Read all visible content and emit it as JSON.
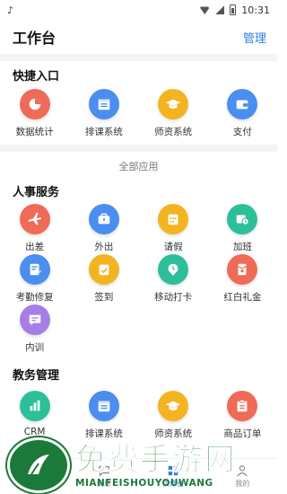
{
  "status_bar": {
    "time": "10:31"
  },
  "header": {
    "title": "工作台",
    "manage": "管理"
  },
  "quick_entry": {
    "title": "快捷入口",
    "items": [
      {
        "label": "数据统计",
        "icon": "pie-chart-icon",
        "color": "#ef6b57"
      },
      {
        "label": "排课系统",
        "icon": "schedule-icon",
        "color": "#4a8ef0"
      },
      {
        "label": "师资系统",
        "icon": "graduation-cap-icon",
        "color": "#f4b321"
      },
      {
        "label": "支付",
        "icon": "wallet-icon",
        "color": "#4a8ef0"
      }
    ]
  },
  "all_apps": "全部应用",
  "hr": {
    "title": "人事服务",
    "items": [
      {
        "label": "出差",
        "icon": "airplane-icon",
        "color": "#ef6b57"
      },
      {
        "label": "外出",
        "icon": "briefcase-icon",
        "color": "#4a8ef0"
      },
      {
        "label": "请假",
        "icon": "calendar-icon",
        "color": "#f4b321"
      },
      {
        "label": "加班",
        "icon": "overtime-icon",
        "color": "#2cbf9a"
      },
      {
        "label": "考勤修复",
        "icon": "attendance-repair-icon",
        "color": "#4a8ef0"
      },
      {
        "label": "签到",
        "icon": "check-in-icon",
        "color": "#f4b321"
      },
      {
        "label": "移动打卡",
        "icon": "location-clock-icon",
        "color": "#2cbf9a"
      },
      {
        "label": "红白礼金",
        "icon": "red-envelope-icon",
        "color": "#ef6b57"
      },
      {
        "label": "内训",
        "icon": "chat-icon",
        "color": "#a77ee8"
      }
    ]
  },
  "edu": {
    "title": "教务管理",
    "items": [
      {
        "label": "CRM",
        "icon": "bar-chart-icon",
        "color": "#2cbf9a"
      },
      {
        "label": "排课系统",
        "icon": "schedule-icon",
        "color": "#4a8ef0"
      },
      {
        "label": "师资系统",
        "icon": "graduation-cap-icon",
        "color": "#f4b321"
      },
      {
        "label": "商品订单",
        "icon": "order-icon",
        "color": "#ef6b57"
      }
    ]
  },
  "tabs": [
    {
      "label": "首页",
      "icon": "home-icon"
    },
    {
      "label": "消息",
      "icon": "message-icon"
    },
    {
      "label": "工作台",
      "icon": "workbench-icon",
      "active": true
    },
    {
      "label": "我的",
      "icon": "user-icon"
    }
  ],
  "watermark": {
    "big": "免费手游网",
    "small": "MIANFEISHOUYOUWANG"
  }
}
